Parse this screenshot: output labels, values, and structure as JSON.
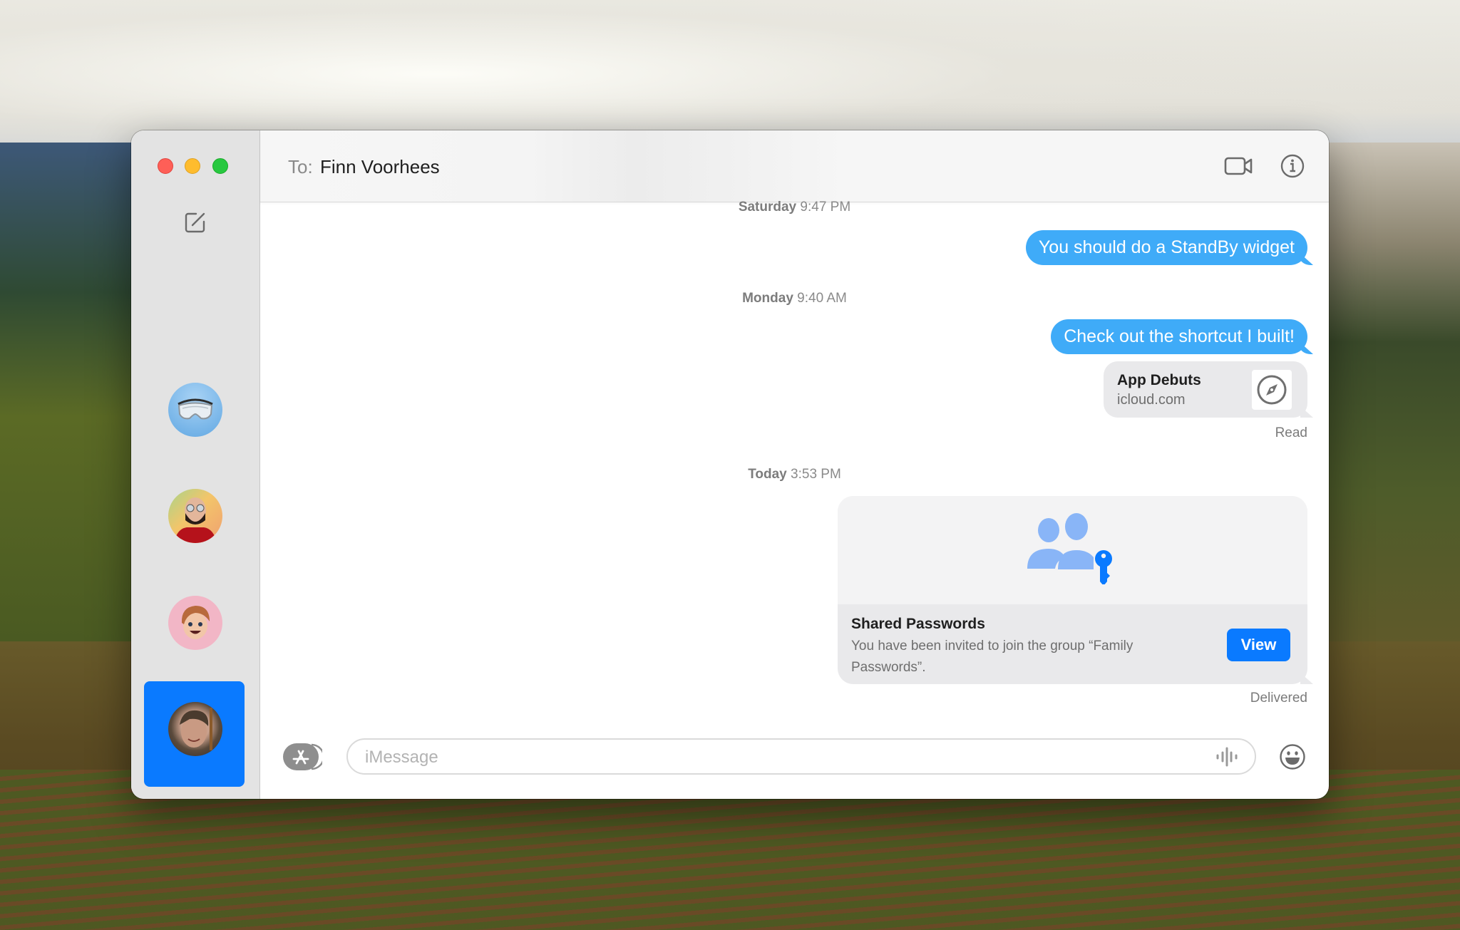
{
  "window": {
    "controls": [
      "close",
      "minimize",
      "maximize"
    ]
  },
  "sidebar": {
    "compose_icon": "compose-icon",
    "conversations": [
      {
        "avatar": "safety-goggles-avatar",
        "selected": false
      },
      {
        "avatar": "bearded-man-sunglasses-avatar",
        "selected": false
      },
      {
        "avatar": "memoji-woman-avatar",
        "selected": false
      },
      {
        "avatar": "smiling-boy-photo-avatar",
        "selected": false
      },
      {
        "avatar": "finn-voorhees-photo-avatar",
        "selected": true
      }
    ]
  },
  "header": {
    "to_label": "To:",
    "recipient": "Finn Voorhees",
    "video_icon": "video-camera-icon",
    "info_icon": "info-icon"
  },
  "conversation": {
    "timestamps": [
      {
        "day": "Saturday",
        "time": "9:47 PM"
      },
      {
        "day": "Monday",
        "time": "9:40 AM"
      },
      {
        "day": "Today",
        "time": "3:53 PM"
      }
    ],
    "messages": [
      {
        "text": "You should do a StandBy widget",
        "sender": "me"
      },
      {
        "text": "Check out the shortcut I built!",
        "sender": "me"
      }
    ],
    "link_preview": {
      "title": "App Debuts",
      "domain": "icloud.com",
      "icon": "safari-compass-icon"
    },
    "read_status": "Read",
    "shared_passwords_card": {
      "title": "Shared Passwords",
      "description": "You have been invited to join the group “Family Passwords”.",
      "button": "View",
      "icon": "people-with-key-icon"
    },
    "delivered_status": "Delivered"
  },
  "composer": {
    "apps_icon": "app-store-icon",
    "placeholder": "iMessage",
    "value": "",
    "audio_icon": "waveform-icon",
    "emoji_icon": "emoji-icon"
  },
  "colors": {
    "bubble_blue": "#3fabf8",
    "accent_blue": "#0a7aff",
    "received_gray": "#e9e9eb"
  }
}
